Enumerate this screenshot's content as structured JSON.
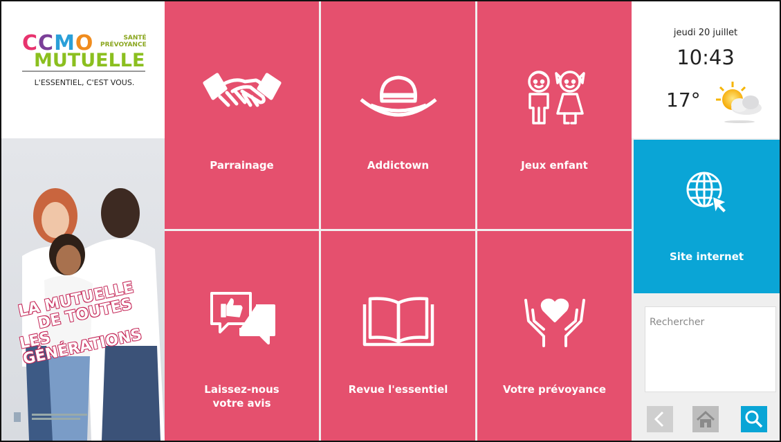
{
  "brand": {
    "logo_ccmo_letters": [
      "C",
      "C",
      "M",
      "O"
    ],
    "logo_ccmo_colors": [
      "#e8336e",
      "#7b3f98",
      "#2a9fd8",
      "#f08c1e"
    ],
    "logo_sante_line1": "SANTÉ",
    "logo_sante_line2": "PRÉVOYANCE",
    "logo_mutuelle": "MUTUELLE",
    "tagline": "L'ESSENTIEL, C'EST VOUS."
  },
  "poster": {
    "slogan_line1": "LA MUTUELLE",
    "slogan_line2": "DE TOUTES",
    "slogan_line3": "LES GÉNÉRATIONS"
  },
  "tiles": [
    {
      "label": "Parrainage",
      "icon": "handshake-icon"
    },
    {
      "label": "Addictown",
      "icon": "hat-icon"
    },
    {
      "label": "Jeux enfant",
      "icon": "children-icon"
    },
    {
      "label": "Laissez-nous\nvotre avis",
      "icon": "feedback-icon"
    },
    {
      "label": "Revue l'essentiel",
      "icon": "book-icon"
    },
    {
      "label": "Votre prévoyance",
      "icon": "heart-hands-icon"
    }
  ],
  "weather": {
    "date": "jeudi 20 juillet",
    "time": "10:43",
    "temperature": "17°",
    "icon": "sun-cloud-icon"
  },
  "site": {
    "label": "Site internet",
    "icon": "globe-cursor-icon"
  },
  "search": {
    "placeholder": "Rechercher"
  },
  "nav": {
    "back_icon": "chevron-left-icon",
    "home_icon": "home-icon",
    "search_icon": "search-icon"
  },
  "colors": {
    "tile": "#e5506e",
    "site": "#0aa5d6",
    "nav_active": "#0aa5d6",
    "nav_inactive": "#c8c8c8"
  }
}
